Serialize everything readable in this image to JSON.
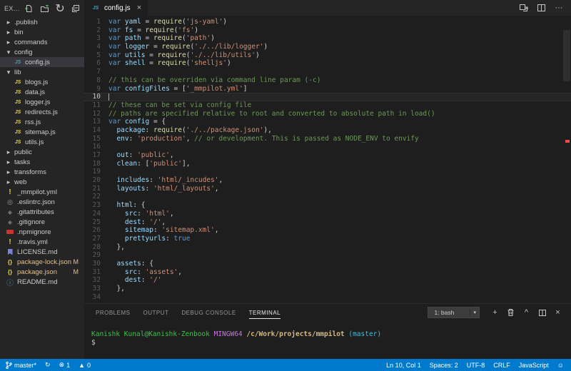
{
  "explorer": {
    "title": "EX...",
    "actions": [
      "new-file",
      "new-folder",
      "refresh",
      "collapse-all"
    ],
    "items": [
      {
        "label": ".publish",
        "icon": "chev-r",
        "depth": 0
      },
      {
        "label": "bin",
        "icon": "chev-r",
        "depth": 0
      },
      {
        "label": "commands",
        "icon": "chev-r",
        "depth": 0
      },
      {
        "label": "config",
        "icon": "chev-d",
        "depth": 0
      },
      {
        "label": "config.js",
        "icon": "js-blue",
        "depth": 1,
        "selected": true
      },
      {
        "label": "lib",
        "icon": "chev-d",
        "depth": 0
      },
      {
        "label": "blogs.js",
        "icon": "js",
        "depth": 1
      },
      {
        "label": "data.js",
        "icon": "js",
        "depth": 1
      },
      {
        "label": "logger.js",
        "icon": "js",
        "depth": 1
      },
      {
        "label": "redirects.js",
        "icon": "js",
        "depth": 1
      },
      {
        "label": "rss.js",
        "icon": "js",
        "depth": 1
      },
      {
        "label": "sitemap.js",
        "icon": "js",
        "depth": 1
      },
      {
        "label": "utils.js",
        "icon": "js",
        "depth": 1
      },
      {
        "label": "public",
        "icon": "chev-r",
        "depth": 0
      },
      {
        "label": "tasks",
        "icon": "chev-r",
        "depth": 0
      },
      {
        "label": "transforms",
        "icon": "chev-r",
        "depth": 0
      },
      {
        "label": "web",
        "icon": "chev-r",
        "depth": 0
      },
      {
        "label": "_mmpilot.yml",
        "icon": "warn",
        "depth": 0
      },
      {
        "label": ".eslintrc.json",
        "icon": "gear",
        "depth": 0
      },
      {
        "label": ".gitattributes",
        "icon": "diamond",
        "depth": 0
      },
      {
        "label": ".gitignore",
        "icon": "diamond",
        "depth": 0
      },
      {
        "label": ".npmignore",
        "icon": "npm",
        "depth": 0
      },
      {
        "label": ".travis.yml",
        "icon": "warn",
        "depth": 0
      },
      {
        "label": "LICENSE.md",
        "icon": "license",
        "depth": 0
      },
      {
        "label": "package-lock.json",
        "icon": "braces",
        "depth": 0,
        "badge": "M",
        "modified": true
      },
      {
        "label": "package.json",
        "icon": "braces",
        "depth": 0,
        "badge": "M",
        "modified": true
      },
      {
        "label": "README.md",
        "icon": "info",
        "depth": 0
      }
    ]
  },
  "editor": {
    "tab": {
      "label": "config.js",
      "icon": "js-blue"
    },
    "actions": [
      "open-changes",
      "split-editor",
      "more-actions"
    ],
    "current_line": 10,
    "lines": [
      [
        [
          "k",
          "var "
        ],
        [
          "v",
          "yaml"
        ],
        [
          "p",
          " = "
        ],
        [
          "f",
          "require"
        ],
        [
          "p",
          "("
        ],
        [
          "s",
          "'js-yaml'"
        ],
        [
          "p",
          ")"
        ]
      ],
      [
        [
          "k",
          "var "
        ],
        [
          "v",
          "fs"
        ],
        [
          "p",
          " = "
        ],
        [
          "f",
          "require"
        ],
        [
          "p",
          "("
        ],
        [
          "s",
          "'fs'"
        ],
        [
          "p",
          ")"
        ]
      ],
      [
        [
          "k",
          "var "
        ],
        [
          "v",
          "path"
        ],
        [
          "p",
          " = "
        ],
        [
          "f",
          "require"
        ],
        [
          "p",
          "("
        ],
        [
          "s",
          "'path'"
        ],
        [
          "p",
          ")"
        ]
      ],
      [
        [
          "k",
          "var "
        ],
        [
          "v",
          "logger"
        ],
        [
          "p",
          " = "
        ],
        [
          "f",
          "require"
        ],
        [
          "p",
          "("
        ],
        [
          "s",
          "'./../lib/logger'"
        ],
        [
          "p",
          ")"
        ]
      ],
      [
        [
          "k",
          "var "
        ],
        [
          "v",
          "utils"
        ],
        [
          "p",
          " = "
        ],
        [
          "f",
          "require"
        ],
        [
          "p",
          "("
        ],
        [
          "s",
          "'./../lib/utils'"
        ],
        [
          "p",
          ")"
        ]
      ],
      [
        [
          "k",
          "var "
        ],
        [
          "v",
          "shell"
        ],
        [
          "p",
          " = "
        ],
        [
          "f",
          "require"
        ],
        [
          "p",
          "("
        ],
        [
          "s",
          "'shelljs'"
        ],
        [
          "p",
          ")"
        ]
      ],
      [],
      [
        [
          "m",
          "// this can be overriden via command line param (-c)"
        ]
      ],
      [
        [
          "k",
          "var "
        ],
        [
          "v",
          "configFiles"
        ],
        [
          "p",
          " = ["
        ],
        [
          "s",
          "'_mmpilot.yml'"
        ],
        [
          "p",
          "]"
        ]
      ],
      [],
      [
        [
          "m",
          "// these can be set via config file"
        ]
      ],
      [
        [
          "m",
          "// paths are specified relative to root and converted to absolute path in load()"
        ]
      ],
      [
        [
          "k",
          "var "
        ],
        [
          "v",
          "config"
        ],
        [
          "p",
          " = {"
        ]
      ],
      [
        [
          "p",
          "  "
        ],
        [
          "v",
          "package"
        ],
        [
          "p",
          ": "
        ],
        [
          "f",
          "require"
        ],
        [
          "p",
          "("
        ],
        [
          "s",
          "'./../package.json'"
        ],
        [
          "p",
          "),"
        ]
      ],
      [
        [
          "p",
          "  "
        ],
        [
          "v",
          "env"
        ],
        [
          "p",
          ": "
        ],
        [
          "s",
          "'production'"
        ],
        [
          "p",
          ", "
        ],
        [
          "m",
          "// or development. This is passed as NODE_ENV to envify"
        ]
      ],
      [],
      [
        [
          "p",
          "  "
        ],
        [
          "v",
          "out"
        ],
        [
          "p",
          ": "
        ],
        [
          "s",
          "'public'"
        ],
        [
          "p",
          ","
        ]
      ],
      [
        [
          "p",
          "  "
        ],
        [
          "v",
          "clean"
        ],
        [
          "p",
          ": ["
        ],
        [
          "s",
          "'public'"
        ],
        [
          "p",
          "],"
        ]
      ],
      [],
      [
        [
          "p",
          "  "
        ],
        [
          "v",
          "includes"
        ],
        [
          "p",
          ": "
        ],
        [
          "s",
          "'html/_incudes'"
        ],
        [
          "p",
          ","
        ]
      ],
      [
        [
          "p",
          "  "
        ],
        [
          "v",
          "layouts"
        ],
        [
          "p",
          ": "
        ],
        [
          "s",
          "'html/_layouts'"
        ],
        [
          "p",
          ","
        ]
      ],
      [],
      [
        [
          "p",
          "  "
        ],
        [
          "v",
          "html"
        ],
        [
          "p",
          ": {"
        ]
      ],
      [
        [
          "p",
          "    "
        ],
        [
          "v",
          "src"
        ],
        [
          "p",
          ": "
        ],
        [
          "s",
          "'html'"
        ],
        [
          "p",
          ","
        ]
      ],
      [
        [
          "p",
          "    "
        ],
        [
          "v",
          "dest"
        ],
        [
          "p",
          ": "
        ],
        [
          "s",
          "'/'"
        ],
        [
          "p",
          ","
        ]
      ],
      [
        [
          "p",
          "    "
        ],
        [
          "v",
          "sitemap"
        ],
        [
          "p",
          ": "
        ],
        [
          "s",
          "'sitemap.xml'"
        ],
        [
          "p",
          ","
        ]
      ],
      [
        [
          "p",
          "    "
        ],
        [
          "v",
          "prettyurls"
        ],
        [
          "p",
          ": "
        ],
        [
          "b",
          "true"
        ]
      ],
      [
        [
          "p",
          "  },"
        ]
      ],
      [],
      [
        [
          "p",
          "  "
        ],
        [
          "v",
          "assets"
        ],
        [
          "p",
          ": {"
        ]
      ],
      [
        [
          "p",
          "    "
        ],
        [
          "v",
          "src"
        ],
        [
          "p",
          ": "
        ],
        [
          "s",
          "'assets'"
        ],
        [
          "p",
          ","
        ]
      ],
      [
        [
          "p",
          "    "
        ],
        [
          "v",
          "dest"
        ],
        [
          "p",
          ": "
        ],
        [
          "s",
          "'/'"
        ]
      ],
      [
        [
          "p",
          "  },"
        ]
      ],
      []
    ]
  },
  "panel": {
    "tabs": [
      {
        "label": "PROBLEMS",
        "active": false
      },
      {
        "label": "OUTPUT",
        "active": false
      },
      {
        "label": "DEBUG CONSOLE",
        "active": false
      },
      {
        "label": "TERMINAL",
        "active": true
      }
    ],
    "terminal_selector": {
      "value": "1: bash"
    },
    "actions": [
      "new-terminal",
      "kill-terminal",
      "maximize-panel",
      "split-terminal",
      "close-panel"
    ],
    "terminal_lines": [
      [
        [
          "green",
          "Kanishk Kunal@Kanishk-Zenbook "
        ],
        [
          "mag",
          "MINGW64 "
        ],
        [
          "yellow",
          "/c/Work/projects/mmpilot "
        ],
        [
          "cyan",
          "(master)"
        ]
      ],
      [
        [
          "white",
          "$"
        ]
      ]
    ]
  },
  "status_bar": {
    "left": [
      {
        "name": "git-branch-indicator",
        "icon": "branch",
        "text": "master*"
      },
      {
        "name": "sync-indicator",
        "icon": "sync",
        "text": ""
      },
      {
        "name": "error-count",
        "icon": "error",
        "text": "1"
      },
      {
        "name": "warning-count",
        "icon": "warning",
        "text": "0"
      }
    ],
    "right": [
      {
        "name": "cursor-position",
        "text": "Ln 10, Col 1"
      },
      {
        "name": "indentation",
        "text": "Spaces: 2"
      },
      {
        "name": "encoding",
        "text": "UTF-8"
      },
      {
        "name": "eol",
        "text": "CRLF"
      },
      {
        "name": "language-mode",
        "text": "JavaScript"
      },
      {
        "name": "feedback",
        "icon": "smiley",
        "text": ""
      }
    ]
  },
  "icons": {
    "close": "×",
    "chevron_right": "▸",
    "chevron_down": "▾",
    "dropdown_caret": "▾",
    "refresh": "↻",
    "sync": "↻",
    "error": "⊗",
    "warning": "▲",
    "smiley": "☺",
    "more_actions": "···",
    "new_terminal": "+",
    "maximize_panel": "^",
    "close_panel": "×",
    "js_badge": "JS",
    "yaml_warning": "!",
    "gear": "◎",
    "git_diamond": "◆",
    "readme_info": "ⓘ",
    "json_braces": "{}"
  },
  "colors": {
    "accent": "#007acc",
    "editor_bg": "#1e1e1e",
    "sidebar_bg": "#252526",
    "selection_bg": "#37373d",
    "keyword": "#569cd6",
    "variable": "#9cdcfe",
    "function": "#dcdcaa",
    "string": "#ce9178",
    "comment": "#6a9955",
    "punctuation": "#d4d4d4",
    "line_number": "#5a5a5a",
    "git_modified": "#e2c08d",
    "error_marker": "#f14c4c",
    "term_green": "#3fc24c",
    "term_magenta": "#c678dd",
    "term_yellow": "#d7ba7d",
    "term_cyan": "#36c2da",
    "js_icon_yellow": "#e8d44d",
    "js_icon_blue": "#519aba"
  }
}
